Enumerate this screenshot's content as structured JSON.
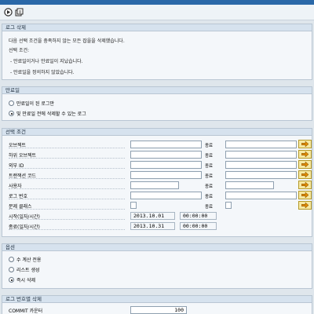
{
  "window": {
    "title": "로그 삭제"
  },
  "toolbar": {
    "execute_icon": "execute-icon",
    "variant_icon": "variant-icon"
  },
  "log_delete": {
    "header": "로그 삭제",
    "line1": "다음 선택 조건을 충족하지 않는 모든 잡을을 삭제했습니다.",
    "line2": "선택 조건:",
    "line3": "- 만료일이거나 만료일이 지났습니다.",
    "line4": "- 만료일을 정의하지 않았습니다."
  },
  "expiry": {
    "header": "만료일",
    "options": [
      {
        "label": "만료일이 된 로그만",
        "selected": false
      },
      {
        "label": "및 만료일 전에 삭제할 수 있는 로그",
        "selected": true
      }
    ]
  },
  "criteria": {
    "header": "선택 조건",
    "to_label": "종료",
    "rows": [
      {
        "label": "오브젝트"
      },
      {
        "label": "하위 오브젝트"
      },
      {
        "label": "외부 ID"
      },
      {
        "label": "트랜잭션 코드"
      },
      {
        "label": "사용자"
      },
      {
        "label": "로그 번호"
      },
      {
        "label": "문제 클래스"
      },
      {
        "label": "시작(일자/시간)",
        "date": "2013.10.01",
        "time": "00:00:00"
      },
      {
        "label": "종료(일자/시간)",
        "date": "2013.10.31",
        "time": "00:00:00"
      }
    ]
  },
  "options": {
    "header": "옵션",
    "items": [
      {
        "label": "수 계산 전용",
        "selected": false
      },
      {
        "label": "리스트 생성",
        "selected": false
      },
      {
        "label": "즉시 삭제",
        "selected": true
      }
    ]
  },
  "log_number_delete": {
    "header": "로그 번호별 삭제",
    "commit_label": "COMMIT 카운터",
    "commit_value": "100"
  }
}
